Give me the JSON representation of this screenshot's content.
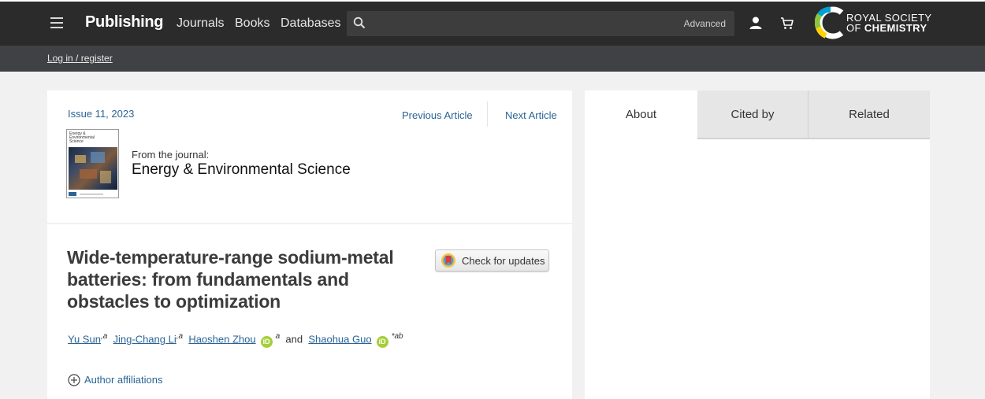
{
  "header": {
    "brand": "Publishing",
    "nav": [
      "Journals",
      "Books",
      "Databases"
    ],
    "search": {
      "placeholder": "",
      "advanced_label": "Advanced"
    },
    "org_logo": {
      "line1": "ROYAL SOCIETY",
      "line2_prefix": "OF ",
      "line2_bold": "CHEMISTRY"
    }
  },
  "subheader": {
    "login_label": "Log in / register"
  },
  "article_nav": {
    "issue": "Issue 11, 2023",
    "previous": "Previous Article",
    "next": "Next Article"
  },
  "journal": {
    "from_label": "From the journal:",
    "name": "Energy & Environmental Science",
    "cover_title": "Energy & Environmental Science"
  },
  "article": {
    "title": "Wide-temperature-range sodium-metal batteries: from fundamentals and obstacles to optimization",
    "check_updates_label": "Check for updates",
    "authors": [
      {
        "name": "Yu Sun",
        "sup": "a",
        "orcid": false
      },
      {
        "name": "Jing-Chang Li",
        "sup": "a",
        "orcid": false
      },
      {
        "name": "Haoshen Zhou",
        "sup": "a",
        "orcid": true
      },
      {
        "name": "Shaohua Guo",
        "sup": "*ab",
        "orcid": true
      }
    ],
    "and_label": "and",
    "orcid_label": "iD",
    "affiliations_label": "Author affiliations"
  },
  "side_tabs": [
    {
      "label": "About",
      "active": true
    },
    {
      "label": "Cited by",
      "active": false
    },
    {
      "label": "Related",
      "active": false
    }
  ],
  "colors": {
    "link": "#2a6496",
    "topbar": "#2b2b2b",
    "subbar": "#3f4144",
    "orcid": "#a6ce39"
  }
}
